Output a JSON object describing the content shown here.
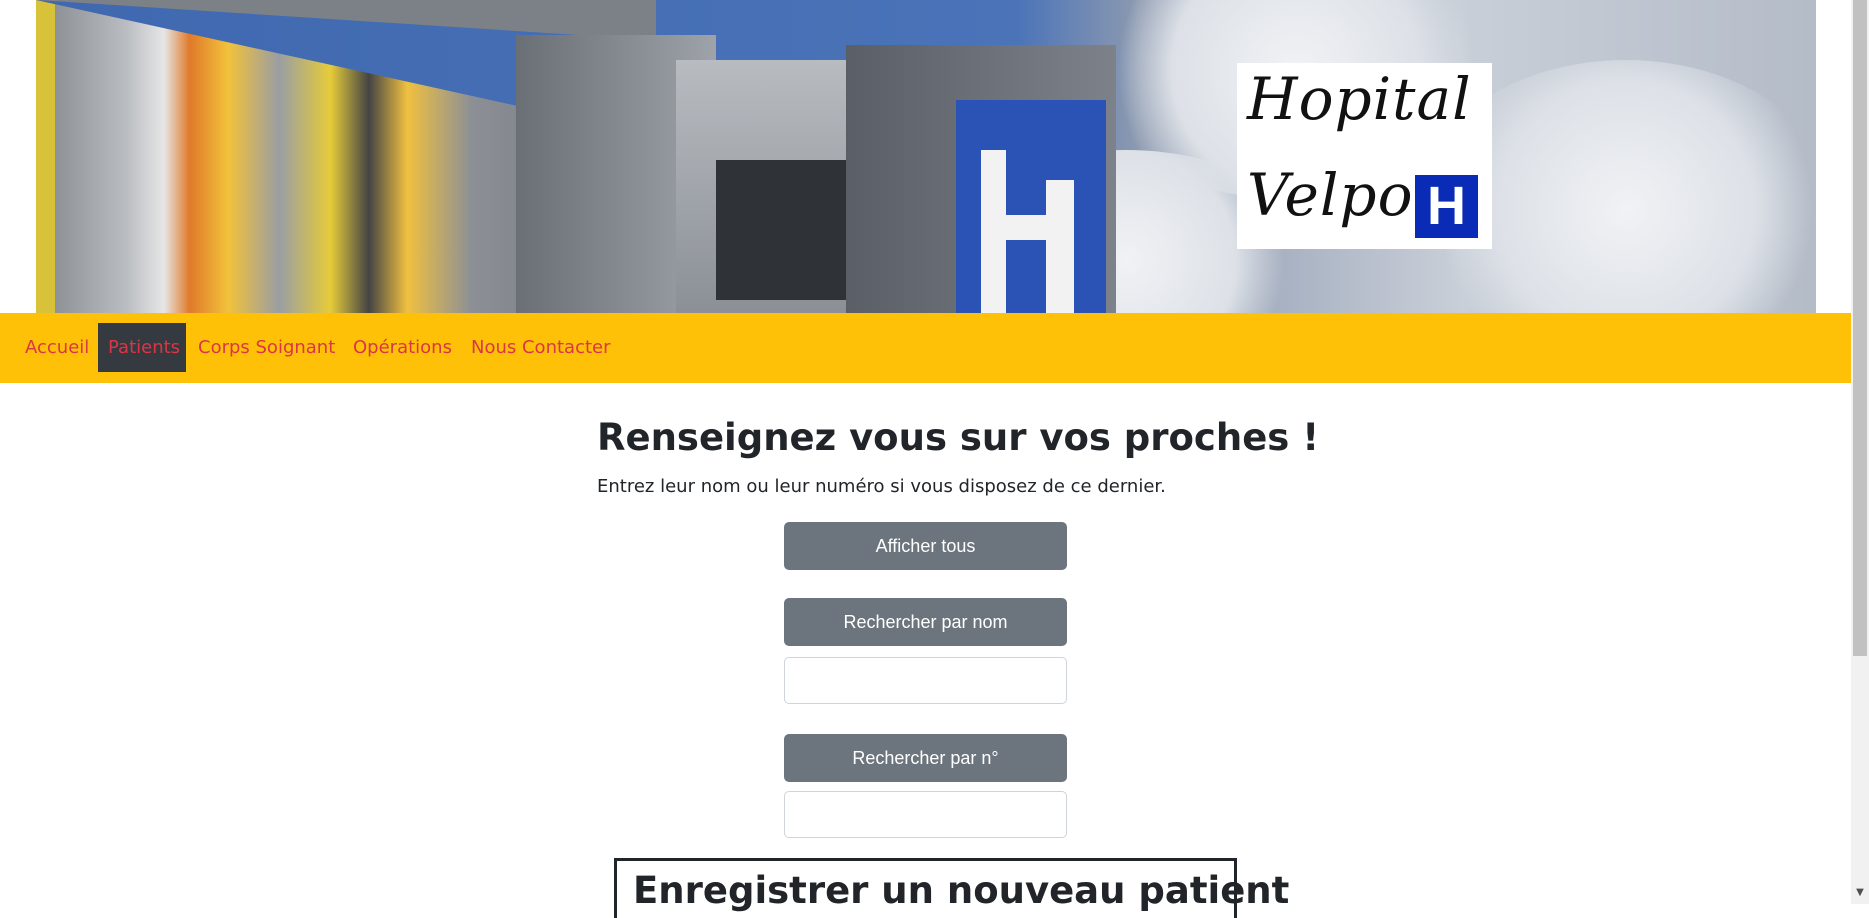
{
  "banner": {
    "logo_text_line1": "Hopital",
    "logo_text_line2": "Velpo",
    "logo_mark": "H"
  },
  "nav": {
    "items": [
      {
        "label": "Accueil"
      },
      {
        "label": "Patients",
        "active": true
      },
      {
        "label": "Corps Soignant"
      },
      {
        "label": "Opérations"
      },
      {
        "label": "Nous Contacter"
      }
    ]
  },
  "main": {
    "title": "Renseignez vous sur vos proches !",
    "subtitle": "Entrez leur nom ou leur numéro si vous disposez de ce dernier.",
    "show_all_label": "Afficher tous",
    "search_name_label": "Rechercher par nom",
    "search_name_value": "",
    "search_number_label": "Rechercher par n°",
    "search_number_value": "",
    "register_title": "Enregistrer un nouveau patient"
  },
  "colors": {
    "navbar": "#ffc107",
    "nav_link": "#dc3545",
    "nav_active_bg": "#343a40",
    "button": "#6c757d",
    "logo_mark": "#0a2bb5"
  }
}
